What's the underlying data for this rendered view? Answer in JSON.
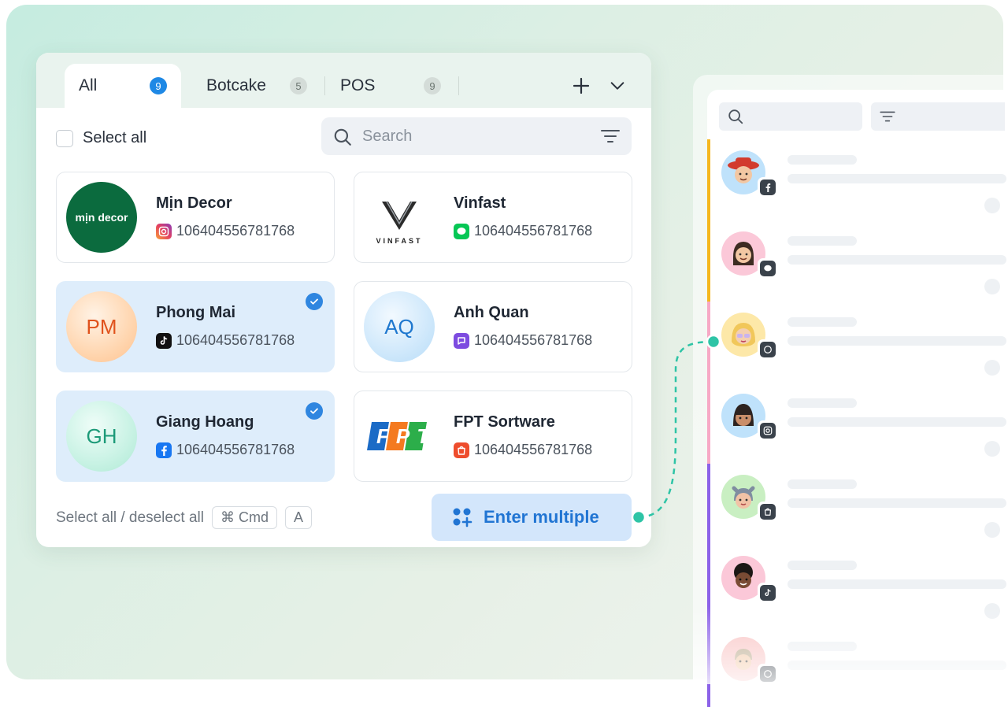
{
  "tabs": [
    {
      "label": "All",
      "count": "9",
      "active": true
    },
    {
      "label": "Botcake",
      "count": "5",
      "active": false
    },
    {
      "label": "POS",
      "count": "9",
      "active": false
    }
  ],
  "select_all_label": "Select all",
  "search": {
    "placeholder": "Search",
    "value": ""
  },
  "pages": [
    {
      "name": "Mịn Decor",
      "id": "106404556781768",
      "channel": "instagram-icon",
      "logo_text": "mịn decor",
      "selected": false
    },
    {
      "name": "Vinfast",
      "id": "106404556781768",
      "channel": "line-icon",
      "logo_text": "VINFAST",
      "selected": false
    },
    {
      "name": "Phong Mai",
      "id": "106404556781768",
      "channel": "tiktok-icon",
      "initials": "PM",
      "selected": true
    },
    {
      "name": "Anh Quan",
      "id": "106404556781768",
      "channel": "viber-icon",
      "initials": "AQ",
      "selected": false
    },
    {
      "name": "Giang Hoang",
      "id": "106404556781768",
      "channel": "facebook-icon",
      "initials": "GH",
      "selected": true
    },
    {
      "name": "FPT Sortware",
      "id": "106404556781768",
      "channel": "shopee-icon",
      "logo_text": "FPT",
      "selected": false
    }
  ],
  "shortcut": {
    "label": "Select all / deselect all",
    "key1": "⌘ Cmd",
    "key2": "A"
  },
  "enter_button": "Enter multiple",
  "colors": {
    "accent": "#1e88e5",
    "button_bg": "#d3e6fb",
    "selected_card": "#deedfb",
    "connector": "#2ec4a6"
  },
  "conversation_list": [
    {
      "avatar_icon": "avatar-cowboy-icon",
      "channel": "facebook-icon",
      "bar_color": "#f5b71f"
    },
    {
      "avatar_icon": "avatar-girl-icon",
      "channel": "line-icon",
      "bar_color": "#f5b71f"
    },
    {
      "avatar_icon": "avatar-blonde-icon",
      "channel": "whatsapp-icon",
      "bar_color": "#f7a9c6"
    },
    {
      "avatar_icon": "avatar-bangs-icon",
      "channel": "instagram-icon",
      "bar_color": "#f7a9c6"
    },
    {
      "avatar_icon": "avatar-cat-ears-icon",
      "channel": "shopee-icon",
      "bar_color": "#8c62e8"
    },
    {
      "avatar_icon": "avatar-curly-icon",
      "channel": "tiktok-icon",
      "bar_color": "#8c62e8"
    },
    {
      "avatar_icon": "avatar-boy-icon",
      "channel": "whatsapp-icon",
      "bar_color": "#8c62e8"
    }
  ]
}
